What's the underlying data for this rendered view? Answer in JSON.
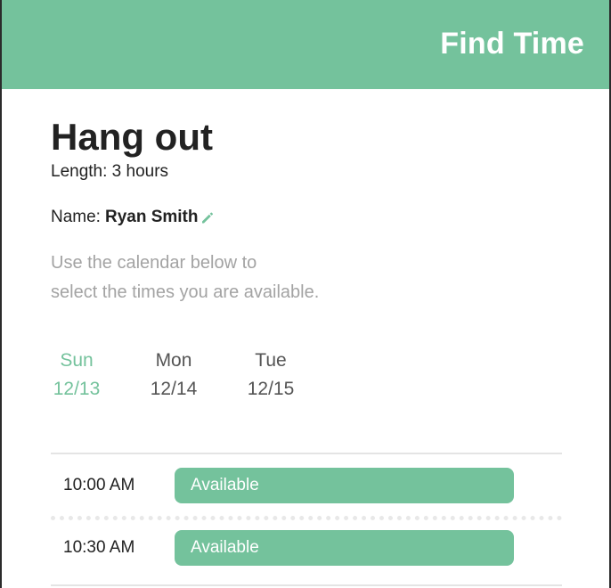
{
  "header": {
    "title": "Find Time"
  },
  "event": {
    "title": "Hang out",
    "length": "Length: 3 hours",
    "name_label": "Name:",
    "name_value": "Ryan Smith",
    "instructions_line1": "Use the calendar below to",
    "instructions_line2": "select the times you are available."
  },
  "days": [
    {
      "weekday": "Sun",
      "date": "12/13",
      "selected": true
    },
    {
      "weekday": "Mon",
      "date": "12/14",
      "selected": false
    },
    {
      "weekday": "Tue",
      "date": "12/15",
      "selected": false
    }
  ],
  "slots": [
    {
      "time": "10:00 AM",
      "status": "Available"
    },
    {
      "time": "10:30 AM",
      "status": "Available"
    }
  ],
  "colors": {
    "accent": "#74c29c",
    "text": "#222222",
    "muted": "#a3a3a3"
  },
  "icons": {
    "edit": "pencil-icon"
  }
}
